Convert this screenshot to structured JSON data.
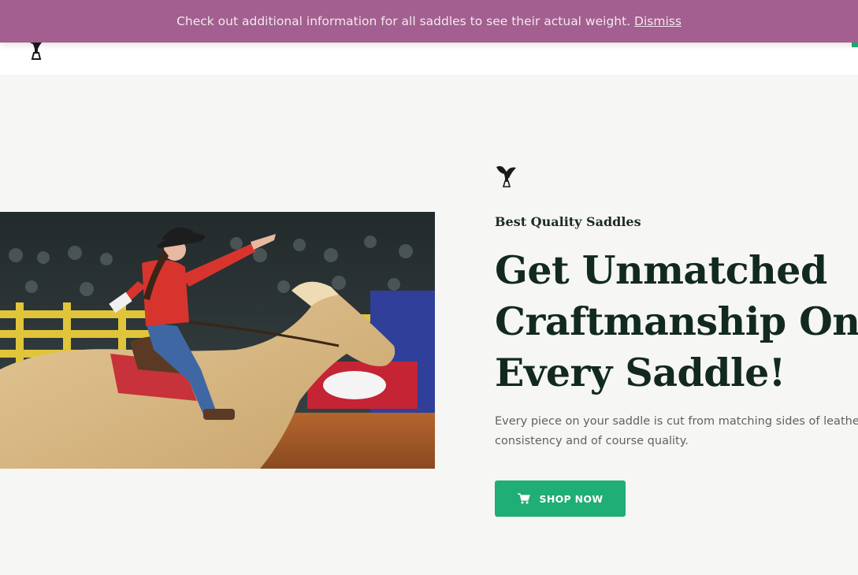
{
  "notice": {
    "message": "Check out additional information for all saddles to see their actual weight.",
    "dismiss_label": "Dismiss"
  },
  "header": {
    "logo_icon": "saddle-logo-icon"
  },
  "hero": {
    "icon": "saddle-icon",
    "eyebrow": "Best Quality Saddles",
    "headline_lines": [
      "Get Unmatched",
      "Craftmanship On",
      "Every Saddle!"
    ],
    "description_lines": [
      "Every piece on your saddle is cut from matching sides of leather f",
      "consistency and of course quality."
    ],
    "cta_label": "SHOP NOW",
    "cta_icon": "cart-icon"
  },
  "colors": {
    "notice_bg": "#a25f8f",
    "accent_green": "#1fae75",
    "heading_dark": "#12291f"
  }
}
